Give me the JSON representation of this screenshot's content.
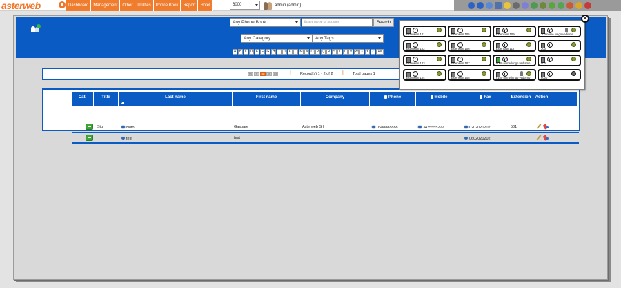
{
  "app": {
    "logo_text": "asterweb"
  },
  "nav": {
    "items": [
      "Dashboard",
      "Management",
      "Other",
      "Utilities",
      "Phone Book",
      "Report",
      "Hotel"
    ]
  },
  "extension_selector": {
    "value": "6000"
  },
  "user": {
    "name": "admin (admin)"
  },
  "search": {
    "phonebook_select": "Any Phone Book",
    "input_placeholder": "Insert name or number",
    "button_label": "Search",
    "category_select": "Any Category",
    "tags_select": "Any Tags",
    "letters": [
      "A",
      "B",
      "C",
      "D",
      "E",
      "F",
      "G",
      "H",
      "I",
      "J",
      "K",
      "L",
      "M",
      "N",
      "O",
      "P",
      "Q",
      "R",
      "S",
      "T",
      "U",
      "V",
      "W",
      "X",
      "Y",
      "Z",
      "All"
    ]
  },
  "pager": {
    "buttons": [
      "<<",
      "<",
      "1",
      ">",
      ">>"
    ],
    "current_page": "1",
    "records_text": "Record(s) 1 - 2 of 2",
    "total_pages_text": "Total pages 1"
  },
  "table": {
    "headers": {
      "category": "Cat.",
      "title": "Title",
      "last_name": "Last name",
      "first_name": "First name",
      "company": "Company",
      "phone": "Phone",
      "mobile": "Mobile",
      "fax": "Fax",
      "extension": "Extension",
      "action": "Action"
    },
    "rows": [
      {
        "title": "Sig.",
        "last_name": "Noto",
        "first_name": "Gaspare",
        "company": "Asterweb Srl",
        "phone": "0688888888",
        "mobile": "3425555222",
        "fax": "0202020202",
        "extension": "501"
      },
      {
        "title": "",
        "last_name": "test",
        "first_name": "test",
        "company": "",
        "phone": "",
        "mobile": "",
        "fax": "0602020202",
        "extension": ""
      }
    ]
  },
  "extensions_popup": {
    "items": [
      {
        "label": "Extension 101",
        "status": "available"
      },
      {
        "label": "Extension 105",
        "status": "available"
      },
      {
        "label": "Extension 109",
        "status": "available"
      },
      {
        "label": "200 nome lungo vediamo",
        "status": "available"
      },
      {
        "label": "Extension 102",
        "status": "available"
      },
      {
        "label": "Extension 106",
        "status": "available"
      },
      {
        "label": "Extension 110",
        "status": "available"
      },
      {
        "label": "300",
        "status": "available"
      },
      {
        "label": "Extension 103",
        "status": "available"
      },
      {
        "label": "Extension 107",
        "status": "available"
      },
      {
        "label": "5000 nome lungo vediamo",
        "status": "available"
      },
      {
        "label": "400",
        "status": "available"
      },
      {
        "label": "Extension 104",
        "status": "available"
      },
      {
        "label": "Extension 108",
        "status": "available"
      },
      {
        "label": "6100 nome lungo vediamo",
        "status": "available"
      },
      {
        "label": "6000",
        "status": "offline"
      }
    ]
  },
  "colors": {
    "brand_orange": "#f07c2e",
    "header_blue": "#0a5bc4",
    "status_green": "#8a9a33"
  }
}
